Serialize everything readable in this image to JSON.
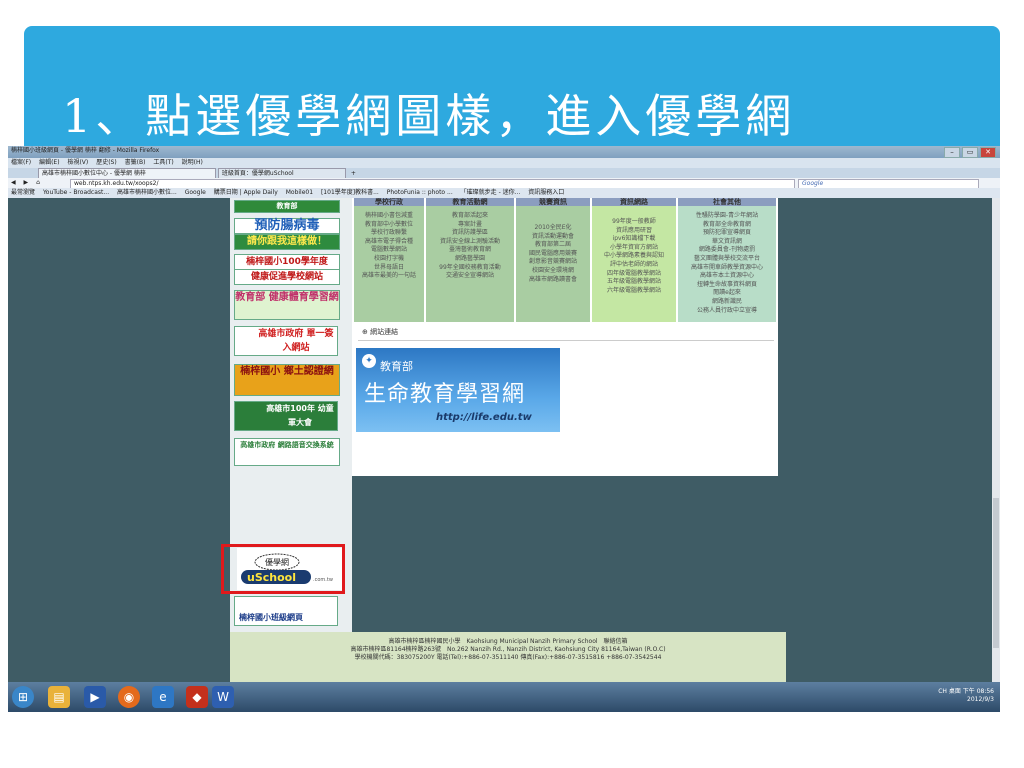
{
  "slide": {
    "title": "1、點選優學網圖樣，進入優學網"
  },
  "browser": {
    "window_title": "楠梓國小班級網頁 - 優學網 楠梓 翻修 - Mozilla Firefox",
    "menu": [
      "檔案(F)",
      "編輯(E)",
      "檢視(V)",
      "歷史(S)",
      "書籤(B)",
      "工具(T)",
      "說明(H)"
    ],
    "tabs": [
      "高雄市楠梓國小數位中心 - 優學網 楠梓",
      "班級首頁：優學網uSchool"
    ],
    "url": "web.ntps.kh.edu.tw/xoops2/",
    "search_placeholder": "Google",
    "bookmarks": [
      "最常瀏覽",
      "YouTube - Broadcast...",
      "高雄市楠梓國小數位...",
      "Google",
      "購票日期 | Apple Daily",
      "Mobile01",
      "[101學年度]教科書...",
      "PhotoFunia :: photo ...",
      "「璀璨就步走 - 迷你...",
      "資訊服務入口"
    ]
  },
  "sidebar": {
    "banners": [
      "教育部",
      "預防腸病毒",
      "請你跟我這樣做！",
      "楠梓國小100學年度",
      "健康促進學校網站",
      "教育部 健康體育學習網",
      "高雄市政府 單一簽入網站",
      "楠梓國小 鄉土認證網",
      "高雄市100年 幼童軍大會",
      "高雄市政府 網路語音交換系統",
      "楠梓國小班級網頁"
    ]
  },
  "categories": [
    {
      "heading": "學校行政",
      "items": [
        "楠梓國小書包減重",
        "教育部中小學數位",
        "學校行政聯繫",
        "高雄市電子得合種",
        "電腦數學網站",
        "校園打字機",
        "世界母語日",
        "高雄市最美的一句話"
      ]
    },
    {
      "heading": "教育活動網",
      "items": [
        "教育部活起來",
        "專案計畫",
        "資訊防護學區",
        "資訊安全線上測驗活動",
        "臺灣藝術教育網",
        "網路藝學園",
        "99年全國校務教育活動",
        "交通安全宣導網站"
      ]
    },
    {
      "heading": "競賽資訊",
      "items": [
        "2010全民E化",
        "資訊活動運動會",
        "教育部第二屆",
        "國民電腦應用競賽",
        "創意影音競賽網站",
        "校園安全環境網",
        "高雄市網路讀書會"
      ]
    },
    {
      "heading": "資訊網路",
      "items": [
        "99年度一般教師",
        "資訊應用研習",
        "ipv6知識檔下載",
        "小學年資官方網站",
        "中小學網路素養與認知",
        "評中估老師的網站",
        "四年級電腦教學網站",
        "五年級電腦教學網站",
        "六年級電腦教學網站"
      ]
    },
    {
      "heading": "社會其他",
      "items": [
        "性騷防學園-青少年網站",
        "教育部全命教育網",
        "預防犯罪宣導網頁",
        "華文資訊網",
        "網路委員會-刊物處罰",
        "藝文團體與學校交流平台",
        "高雄市開車師教學資源中心",
        "高雄市本土資源中心",
        "扭轉生命故事資料網頁",
        "閱讀e起來",
        "網路新識民",
        "公務人員行政中立宣導"
      ]
    }
  ],
  "links_section": {
    "label": "網站連結"
  },
  "life_banner": {
    "org": "教育部",
    "title": "生命教育學習網",
    "url": "http://life.edu.tw"
  },
  "uschool": {
    "label": "優學網",
    "brand": "uSchool",
    "domain": ".com.tw"
  },
  "footer": {
    "line1": "高雄市楠梓區楠梓國民小學　Kaohsiung Municipal Nanzih Primary School　聯絡信箱",
    "line2": "高雄市楠梓區81164楠梓路263號　No.262 Nanzih Rd., Nanzih District, Kaohsiung City 81164,Taiwan (R.O.C)",
    "line3": "學校機關代碼：383075200Y 電話(Tel):+886-07-3511140 傳真(Fax):+886-07-3515816 +886-07-3542544"
  },
  "taskbar": {
    "time": "下午 08:56",
    "date": "2012/9/3",
    "ime": "CH",
    "desktop": "桌面"
  },
  "colors": {
    "slide_title_bg": "#2ea9df",
    "page_bg": "#3f5c65",
    "highlight": "#e0191c",
    "footer_bg": "#d7e4c4"
  }
}
